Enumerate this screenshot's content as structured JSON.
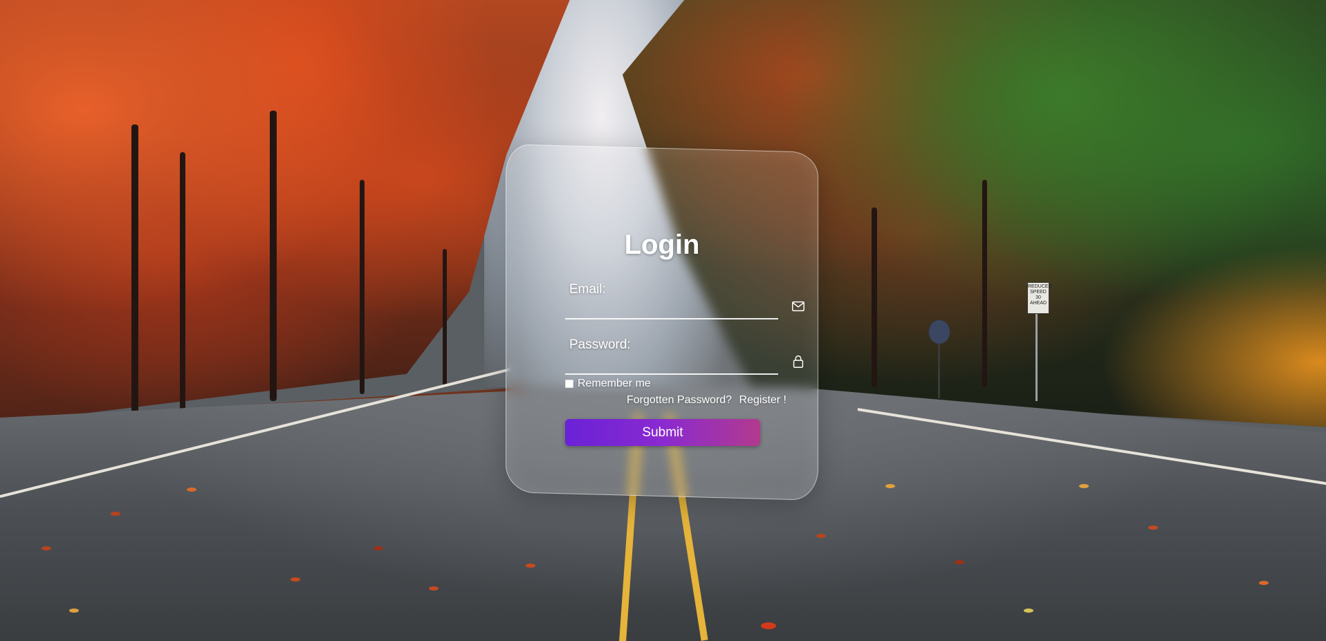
{
  "login": {
    "title": "Login",
    "email_label": "Email:",
    "password_label": "Password:",
    "remember_label": "Remember me",
    "forgot_link": "Forgotten Password?",
    "register_link": "Register !",
    "submit_label": "Submit",
    "email_icon": "envelope-icon",
    "password_icon": "lock-icon"
  },
  "background": {
    "sign_text": "REDUCED SPEED 30 AHEAD"
  },
  "colors": {
    "submit_gradient_start": "#6a22d6",
    "submit_gradient_end": "#b23a8e",
    "text": "#ffffff"
  }
}
